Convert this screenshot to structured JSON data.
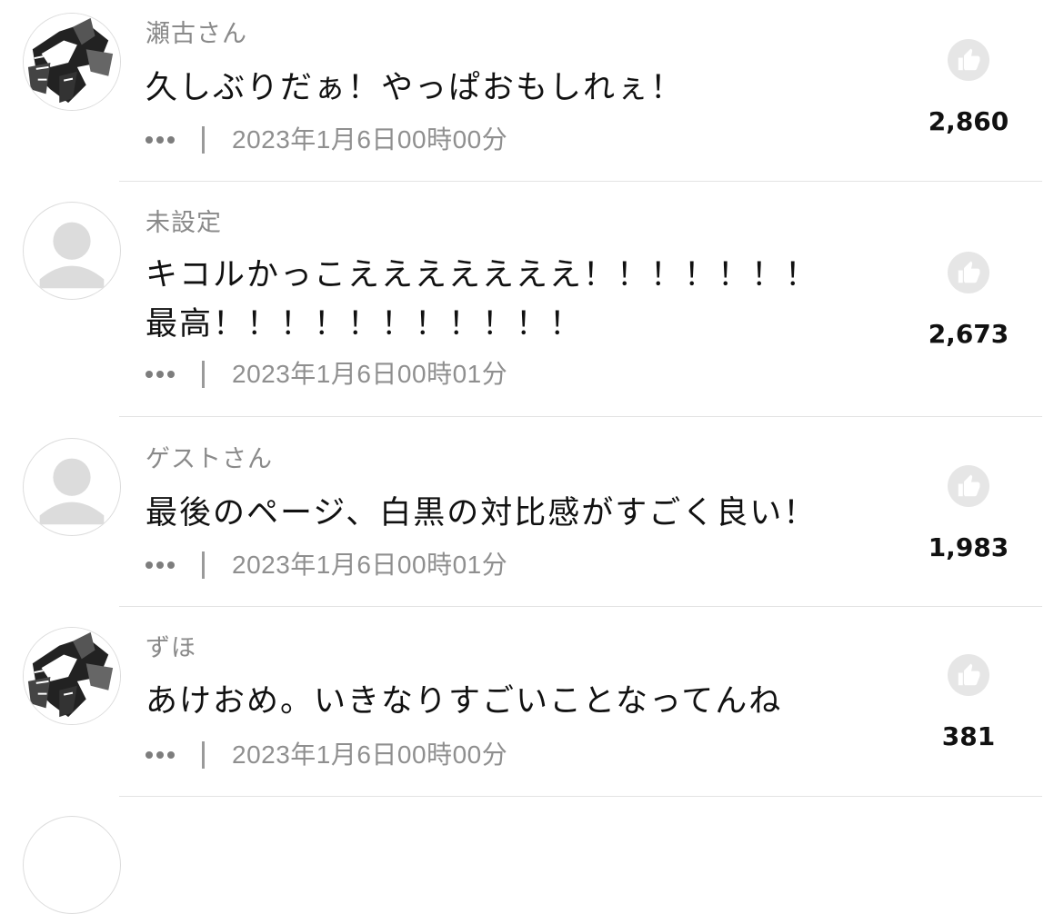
{
  "comments": [
    {
      "username": "瀬古さん",
      "text": "久しぶりだぁ！やっぱおもしれぇ！",
      "timestamp": "2023年1月6日00時00分",
      "likes": "2,860",
      "avatar": "manga-character-avatar"
    },
    {
      "username": "未設定",
      "text": "キコルかっこえええええええ！！！！！！！\n最高！！！！！！！！！！！",
      "timestamp": "2023年1月6日00時01分",
      "likes": "2,673",
      "avatar": "default-user-avatar"
    },
    {
      "username": "ゲストさん",
      "text": "最後のページ、白黒の対比感がすごく良い！",
      "timestamp": "2023年1月6日00時01分",
      "likes": "1,983",
      "avatar": "default-user-avatar"
    },
    {
      "username": "ずほ",
      "text": "あけおめ。いきなりすごいことなってんね",
      "timestamp": "2023年1月6日00時00分",
      "likes": "381",
      "avatar": "manga-character-avatar"
    }
  ],
  "icons": {
    "like": "thumbs-up-icon",
    "more": "more-dots-icon"
  },
  "colors": {
    "username": "#8a8a8a",
    "timestamp": "#8f8f8f",
    "like_bg": "#e6e6e6",
    "divider": "#e3e3e3"
  }
}
